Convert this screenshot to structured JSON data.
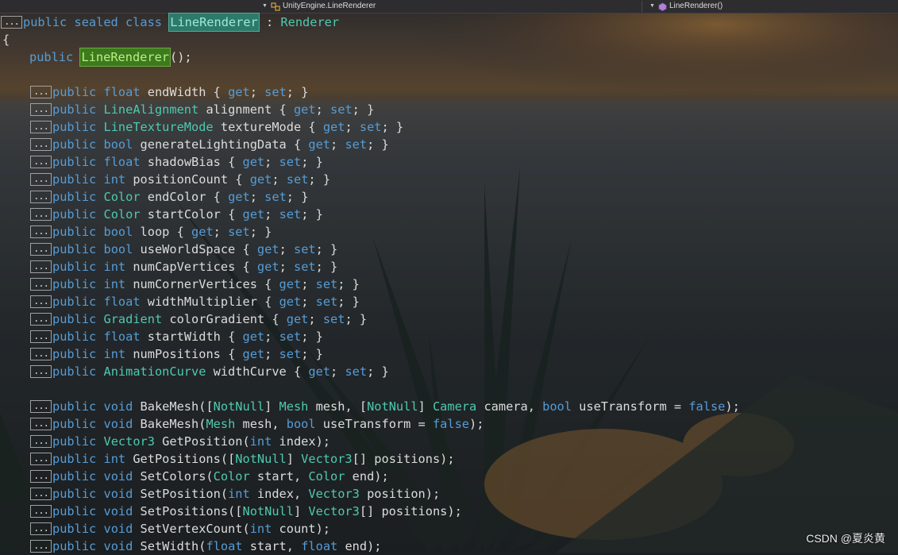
{
  "navbar": {
    "left_label": "UnityEngine.LineRenderer",
    "right_label": "LineRenderer()"
  },
  "colors": {
    "keyword": "#569cd6",
    "type": "#4ec9b0",
    "identifier": "#dcdcdc",
    "class_highlight": "#2c7a6a",
    "ctor_highlight": "#3d7a1e"
  },
  "code": {
    "fold_label": "...",
    "class_line": [
      {
        "t": "public",
        "c": "kw"
      },
      {
        "t": " ",
        "c": "pl"
      },
      {
        "t": "sealed",
        "c": "kw"
      },
      {
        "t": " ",
        "c": "pl"
      },
      {
        "t": "class",
        "c": "kw"
      },
      {
        "t": " ",
        "c": "pl"
      },
      {
        "t": "LineRenderer",
        "c": "hl"
      },
      {
        "t": " : ",
        "c": "pl"
      },
      {
        "t": "Renderer",
        "c": "type"
      }
    ],
    "open_brace": "{",
    "ctor_line": [
      {
        "t": "public",
        "c": "kw"
      },
      {
        "t": " ",
        "c": "pl"
      },
      {
        "t": "LineRenderer",
        "c": "hl2"
      },
      {
        "t": "();",
        "c": "pl"
      }
    ],
    "properties": [
      {
        "type": "float",
        "tk": "kw",
        "name": "endWidth"
      },
      {
        "type": "LineAlignment",
        "tk": "type",
        "name": "alignment"
      },
      {
        "type": "LineTextureMode",
        "tk": "type",
        "name": "textureMode"
      },
      {
        "type": "bool",
        "tk": "kw",
        "name": "generateLightingData"
      },
      {
        "type": "float",
        "tk": "kw",
        "name": "shadowBias"
      },
      {
        "type": "int",
        "tk": "kw",
        "name": "positionCount"
      },
      {
        "type": "Color",
        "tk": "type",
        "name": "endColor"
      },
      {
        "type": "Color",
        "tk": "type",
        "name": "startColor"
      },
      {
        "type": "bool",
        "tk": "kw",
        "name": "loop"
      },
      {
        "type": "bool",
        "tk": "kw",
        "name": "useWorldSpace"
      },
      {
        "type": "int",
        "tk": "kw",
        "name": "numCapVertices"
      },
      {
        "type": "int",
        "tk": "kw",
        "name": "numCornerVertices"
      },
      {
        "type": "float",
        "tk": "kw",
        "name": "widthMultiplier"
      },
      {
        "type": "Gradient",
        "tk": "type",
        "name": "colorGradient"
      },
      {
        "type": "float",
        "tk": "kw",
        "name": "startWidth"
      },
      {
        "type": "int",
        "tk": "kw",
        "name": "numPositions"
      },
      {
        "type": "AnimationCurve",
        "tk": "type",
        "name": "widthCurve"
      }
    ],
    "methods": [
      [
        {
          "t": "public",
          "c": "kw"
        },
        {
          "t": " ",
          "c": "pl"
        },
        {
          "t": "void",
          "c": "kw"
        },
        {
          "t": " BakeMesh(",
          "c": "pl"
        },
        {
          "t": "[",
          "c": "pl"
        },
        {
          "t": "NotNull",
          "c": "attr"
        },
        {
          "t": "] ",
          "c": "pl"
        },
        {
          "t": "Mesh",
          "c": "type"
        },
        {
          "t": " mesh, ",
          "c": "pl"
        },
        {
          "t": "[",
          "c": "pl"
        },
        {
          "t": "NotNull",
          "c": "attr"
        },
        {
          "t": "] ",
          "c": "pl"
        },
        {
          "t": "Camera",
          "c": "type"
        },
        {
          "t": " camera, ",
          "c": "pl"
        },
        {
          "t": "bool",
          "c": "kw"
        },
        {
          "t": " useTransform = ",
          "c": "pl"
        },
        {
          "t": "false",
          "c": "kw"
        },
        {
          "t": ");",
          "c": "pl"
        }
      ],
      [
        {
          "t": "public",
          "c": "kw"
        },
        {
          "t": " ",
          "c": "pl"
        },
        {
          "t": "void",
          "c": "kw"
        },
        {
          "t": " BakeMesh(",
          "c": "pl"
        },
        {
          "t": "Mesh",
          "c": "type"
        },
        {
          "t": " mesh, ",
          "c": "pl"
        },
        {
          "t": "bool",
          "c": "kw"
        },
        {
          "t": " useTransform = ",
          "c": "pl"
        },
        {
          "t": "false",
          "c": "kw"
        },
        {
          "t": ");",
          "c": "pl"
        }
      ],
      [
        {
          "t": "public",
          "c": "kw"
        },
        {
          "t": " ",
          "c": "pl"
        },
        {
          "t": "Vector3",
          "c": "type"
        },
        {
          "t": " GetPosition(",
          "c": "pl"
        },
        {
          "t": "int",
          "c": "kw"
        },
        {
          "t": " index);",
          "c": "pl"
        }
      ],
      [
        {
          "t": "public",
          "c": "kw"
        },
        {
          "t": " ",
          "c": "pl"
        },
        {
          "t": "int",
          "c": "kw"
        },
        {
          "t": " GetPositions(",
          "c": "pl"
        },
        {
          "t": "[",
          "c": "pl"
        },
        {
          "t": "NotNull",
          "c": "attr"
        },
        {
          "t": "] ",
          "c": "pl"
        },
        {
          "t": "Vector3",
          "c": "type"
        },
        {
          "t": "[] positions);",
          "c": "pl"
        }
      ],
      [
        {
          "t": "public",
          "c": "kw"
        },
        {
          "t": " ",
          "c": "pl"
        },
        {
          "t": "void",
          "c": "kw"
        },
        {
          "t": " SetColors(",
          "c": "pl"
        },
        {
          "t": "Color",
          "c": "type"
        },
        {
          "t": " start, ",
          "c": "pl"
        },
        {
          "t": "Color",
          "c": "type"
        },
        {
          "t": " end);",
          "c": "pl"
        }
      ],
      [
        {
          "t": "public",
          "c": "kw"
        },
        {
          "t": " ",
          "c": "pl"
        },
        {
          "t": "void",
          "c": "kw"
        },
        {
          "t": " SetPosition(",
          "c": "pl"
        },
        {
          "t": "int",
          "c": "kw"
        },
        {
          "t": " index, ",
          "c": "pl"
        },
        {
          "t": "Vector3",
          "c": "type"
        },
        {
          "t": " position);",
          "c": "pl"
        }
      ],
      [
        {
          "t": "public",
          "c": "kw"
        },
        {
          "t": " ",
          "c": "pl"
        },
        {
          "t": "void",
          "c": "kw"
        },
        {
          "t": " SetPositions(",
          "c": "pl"
        },
        {
          "t": "[",
          "c": "pl"
        },
        {
          "t": "NotNull",
          "c": "attr"
        },
        {
          "t": "] ",
          "c": "pl"
        },
        {
          "t": "Vector3",
          "c": "type"
        },
        {
          "t": "[] positions);",
          "c": "pl"
        }
      ],
      [
        {
          "t": "public",
          "c": "kw"
        },
        {
          "t": " ",
          "c": "pl"
        },
        {
          "t": "void",
          "c": "kw"
        },
        {
          "t": " SetVertexCount(",
          "c": "pl"
        },
        {
          "t": "int",
          "c": "kw"
        },
        {
          "t": " count);",
          "c": "pl"
        }
      ],
      [
        {
          "t": "public",
          "c": "kw"
        },
        {
          "t": " ",
          "c": "pl"
        },
        {
          "t": "void",
          "c": "kw"
        },
        {
          "t": " SetWidth(",
          "c": "pl"
        },
        {
          "t": "float",
          "c": "kw"
        },
        {
          "t": " start, ",
          "c": "pl"
        },
        {
          "t": "float",
          "c": "kw"
        },
        {
          "t": " end);",
          "c": "pl"
        }
      ]
    ],
    "prop_public": "public",
    "prop_get": "get",
    "prop_set": "set"
  },
  "watermark": "CSDN @夏炎黄"
}
